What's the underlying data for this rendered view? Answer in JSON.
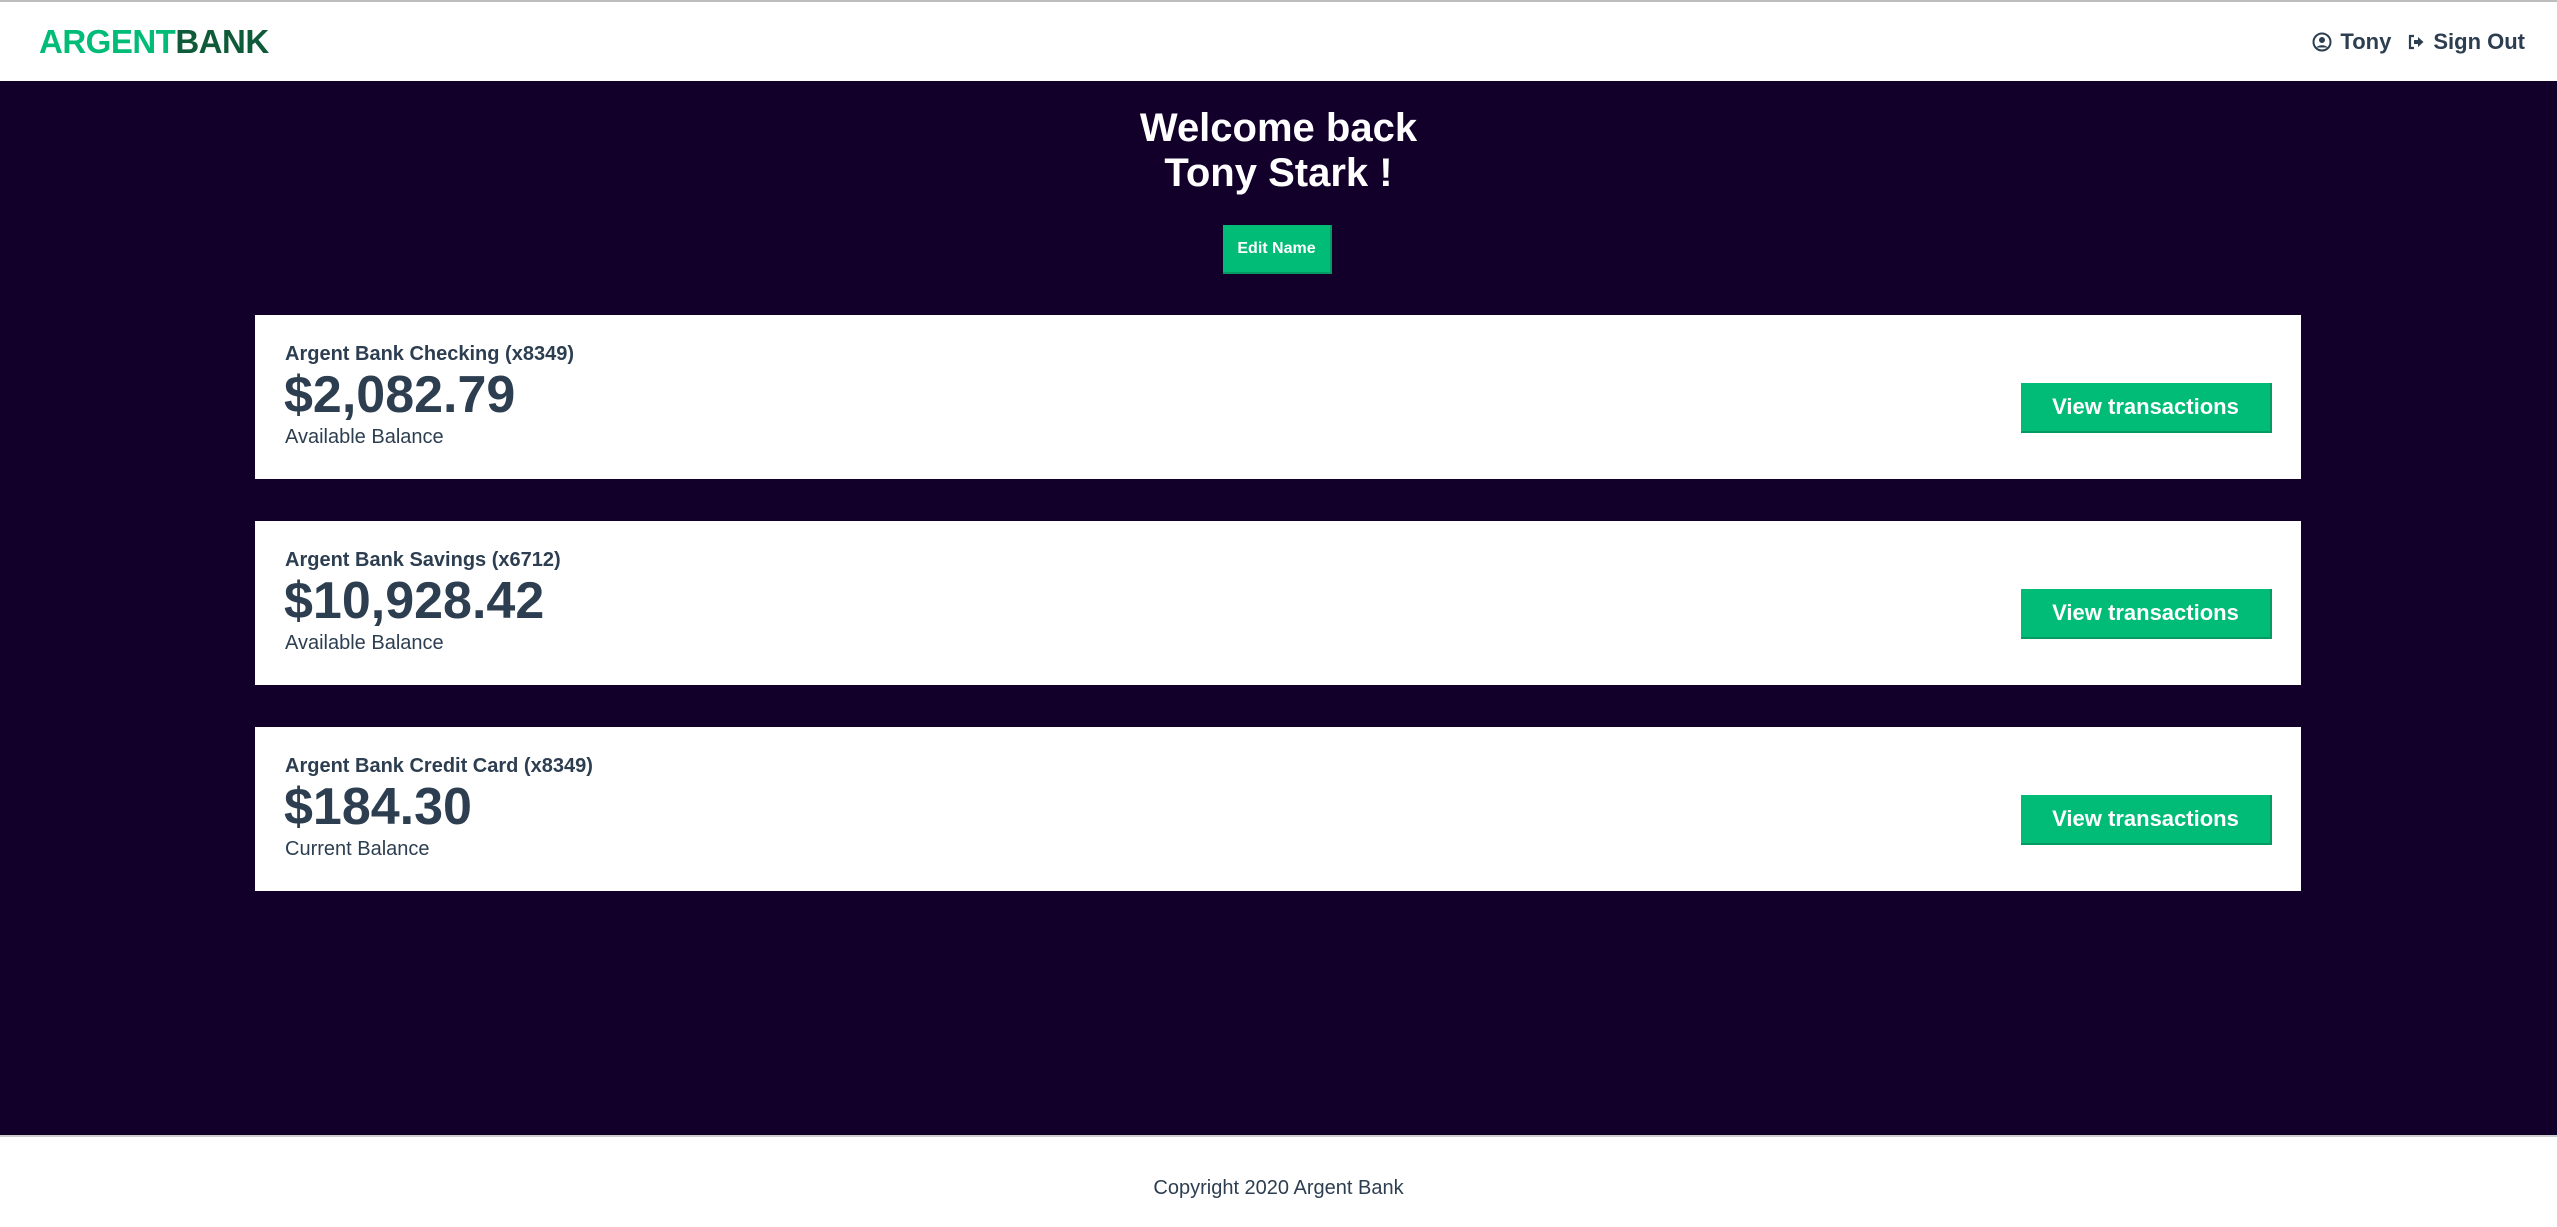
{
  "header": {
    "logo_part1": "ARGENT",
    "logo_part2": "BANK",
    "user_name": "Tony",
    "sign_out_label": "Sign Out",
    "user_icon": "user-circle-icon",
    "sign_out_icon": "sign-out-icon"
  },
  "main": {
    "welcome_line1": "Welcome back",
    "welcome_line2": "Tony Stark !",
    "edit_button_label": "Edit Name",
    "accounts": [
      {
        "title": "Argent Bank Checking (x8349)",
        "amount": "$2,082.79",
        "description": "Available Balance",
        "button_label": "View transactions"
      },
      {
        "title": "Argent Bank Savings (x6712)",
        "amount": "$10,928.42",
        "description": "Available Balance",
        "button_label": "View transactions"
      },
      {
        "title": "Argent Bank Credit Card (x8349)",
        "amount": "$184.30",
        "description": "Current Balance",
        "button_label": "View transactions"
      }
    ]
  },
  "footer": {
    "copyright": "Copyright 2020 Argent Bank"
  },
  "colors": {
    "accent": "#00bc77",
    "logo_dark": "#0f5a38",
    "background_dark": "#12002b",
    "text": "#2c3e50"
  }
}
